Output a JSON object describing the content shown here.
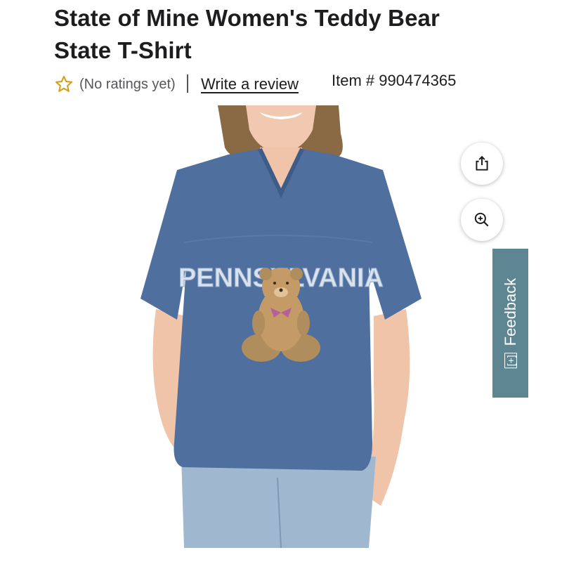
{
  "product": {
    "title_line1": "State of Mine Women's Teddy Bear",
    "title_line2": "State T-Shirt",
    "rating_text": "(No ratings yet)",
    "write_review": "Write a review",
    "item_number": "Item # 990474365",
    "shirt_print_text": "PENNSYLVANIA"
  },
  "actions": {
    "share_icon": "share-icon",
    "zoom_icon": "zoom-in-icon"
  },
  "feedback": {
    "icon_text": "[+]",
    "label": "Feedback"
  },
  "colors": {
    "star": "#d4a017",
    "shirt": "#4f6f9e",
    "feedback_tab": "#5d8592"
  }
}
